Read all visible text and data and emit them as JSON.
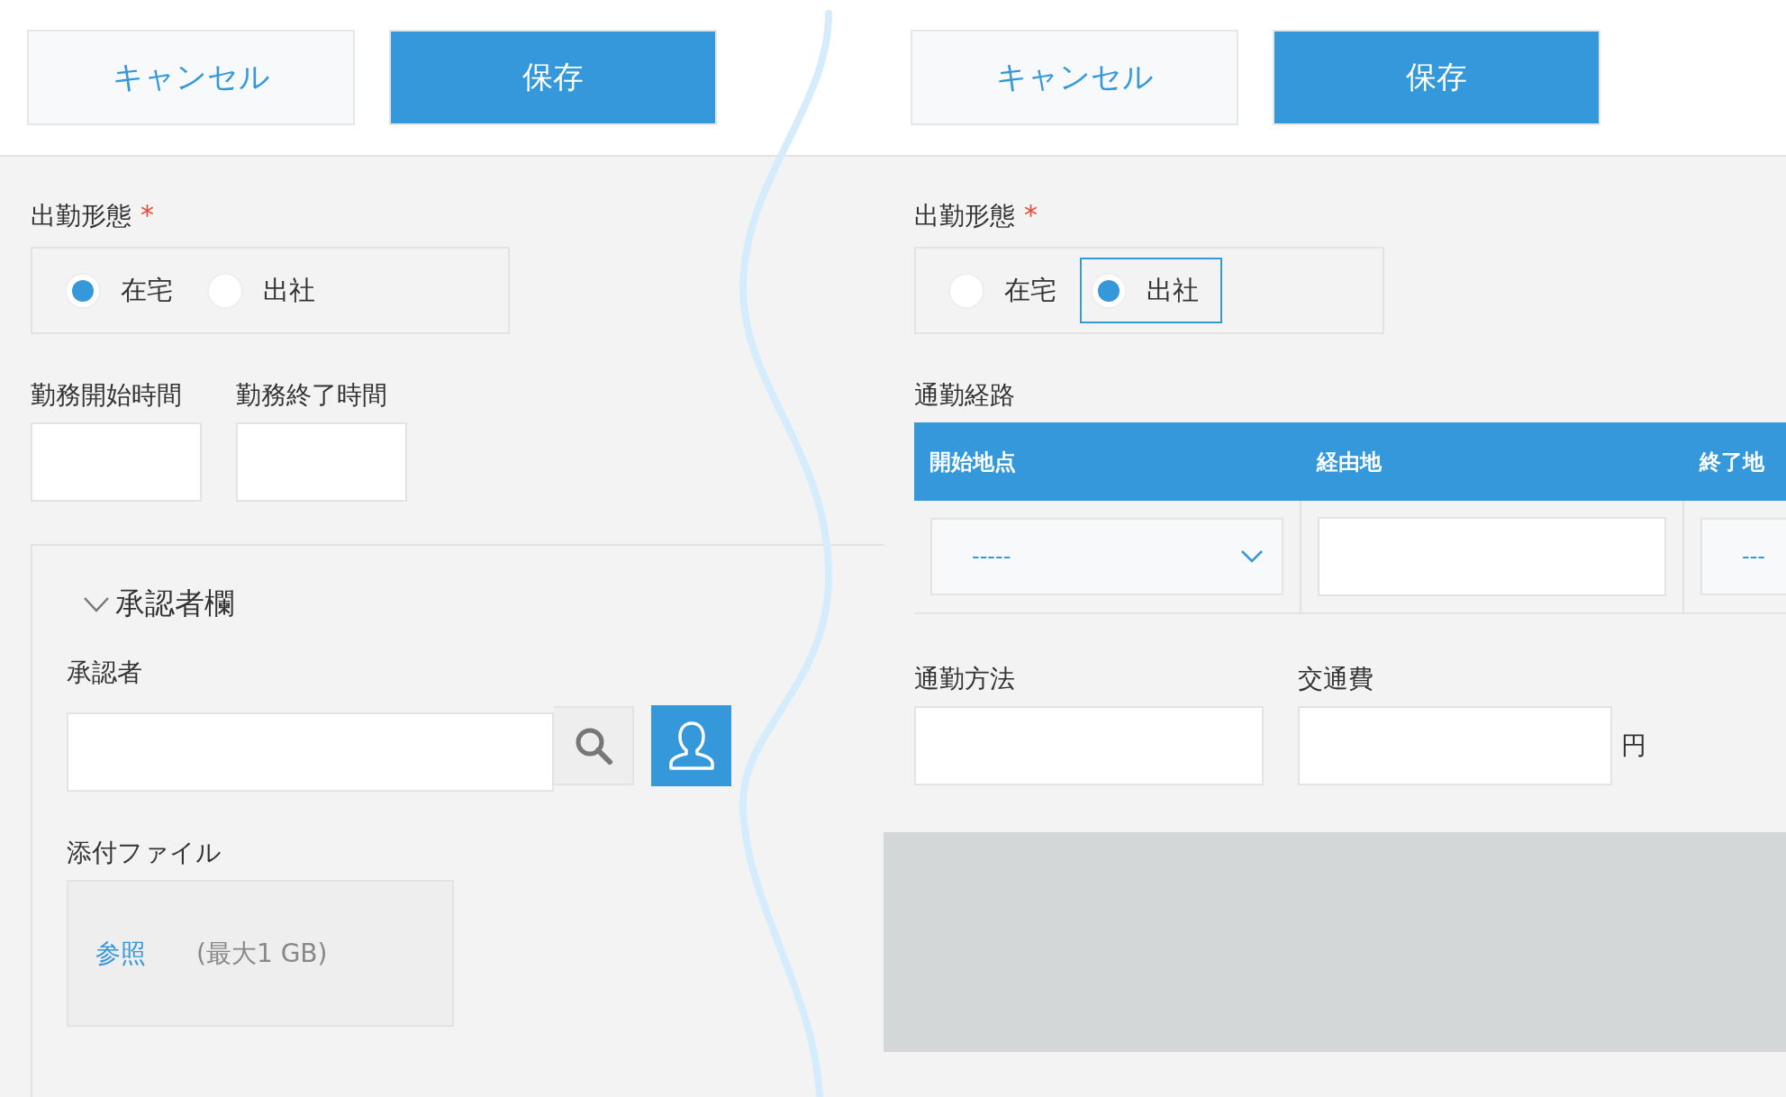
{
  "panels": [
    {
      "buttons": [
        {
          "label": "キャンセル",
          "kind": "secondary"
        },
        {
          "label": "保存",
          "kind": "primary"
        }
      ],
      "blocks": [
        {
          "kind": "radio_group",
          "label": "出勤形態",
          "required_mark": "*",
          "options": [
            {
              "label": "在宅",
              "selected": true,
              "focused": false
            },
            {
              "label": "出社",
              "selected": false,
              "focused": false
            }
          ]
        },
        {
          "kind": "field_row",
          "fields": [
            {
              "label": "勤務開始時間",
              "kind": "time"
            },
            {
              "label": "勤務終了時間",
              "kind": "time"
            }
          ]
        },
        {
          "kind": "section",
          "title": "承認者欄",
          "expanded": true,
          "children": [
            {
              "kind": "user_picker",
              "label": "承認者"
            },
            {
              "kind": "file",
              "label": "添付ファイル",
              "link": "参照",
              "note": "(最大1 GB)"
            }
          ]
        }
      ]
    },
    {
      "buttons": [
        {
          "label": "キャンセル",
          "kind": "secondary"
        },
        {
          "label": "保存",
          "kind": "primary"
        }
      ],
      "blocks": [
        {
          "kind": "radio_group",
          "label": "出勤形態",
          "required_mark": "*",
          "options": [
            {
              "label": "在宅",
              "selected": false,
              "focused": false
            },
            {
              "label": "出社",
              "selected": true,
              "focused": true
            }
          ]
        },
        {
          "kind": "table",
          "label": "通勤経路",
          "columns": [
            "開始地点",
            "経由地",
            "終了地"
          ],
          "cells": [
            {
              "kind": "select",
              "value": "-----"
            },
            {
              "kind": "text"
            },
            {
              "kind": "select",
              "value": "---"
            }
          ]
        },
        {
          "kind": "field_row",
          "fields": [
            {
              "label": "通勤方法",
              "kind": "text"
            },
            {
              "label": "交通費",
              "kind": "number",
              "unit": "円"
            }
          ]
        },
        {
          "kind": "blank_area"
        }
      ]
    }
  ]
}
